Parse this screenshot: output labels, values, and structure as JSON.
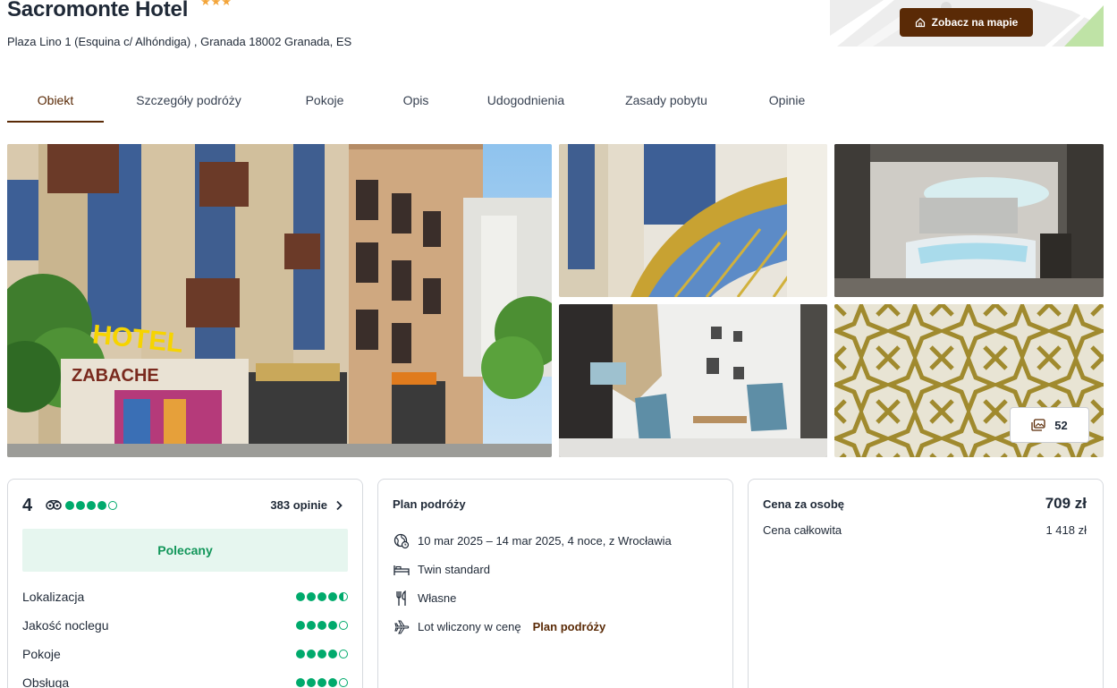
{
  "hotel": {
    "name": "Sacromonte Hotel",
    "stars": "★★★",
    "address": "Plaza Lino 1 (Esquina c/ Alhóndiga) , Granada 18002 Granada, ES"
  },
  "map": {
    "button_label": "Zobacz na mapie",
    "button_icon": "home-icon"
  },
  "tabs": [
    {
      "label": "Obiekt",
      "active": true
    },
    {
      "label": "Szczegóły podróży"
    },
    {
      "label": "Pokoje"
    },
    {
      "label": "Opis"
    },
    {
      "label": "Udogodnienia"
    },
    {
      "label": "Zasady pobytu"
    },
    {
      "label": "Opinie"
    }
  ],
  "gallery": {
    "photo_count": "52",
    "count_icon": "photos-icon"
  },
  "rating": {
    "score": "4",
    "bubbles": 4,
    "opinions_label": "383 opinie",
    "recommended_label": "Polecany",
    "categories": [
      {
        "label": "Lokalizacja",
        "bubbles": 4.5
      },
      {
        "label": "Jakość noclegu",
        "bubbles": 4
      },
      {
        "label": "Pokoje",
        "bubbles": 4
      },
      {
        "label": "Obsługa",
        "bubbles": 4
      }
    ]
  },
  "plan": {
    "title": "Plan podróży",
    "dates": "10 mar 2025 – 14 mar 2025, 4 noce, z Wrocławia",
    "room": "Twin standard",
    "board": "Własne",
    "flight": "Lot wliczony w cenę",
    "flight_link": "Plan podróży"
  },
  "price": {
    "per_person_label": "Cena za osobę",
    "per_person_value": "709 zł",
    "total_label": "Cena całkowita",
    "total_value": "1 418 zł"
  },
  "colors": {
    "accent": "#5a2a06",
    "star": "#f3a53a",
    "tripadvisor_green": "#00aa6c",
    "recommended_bg": "#e6f6ef"
  }
}
